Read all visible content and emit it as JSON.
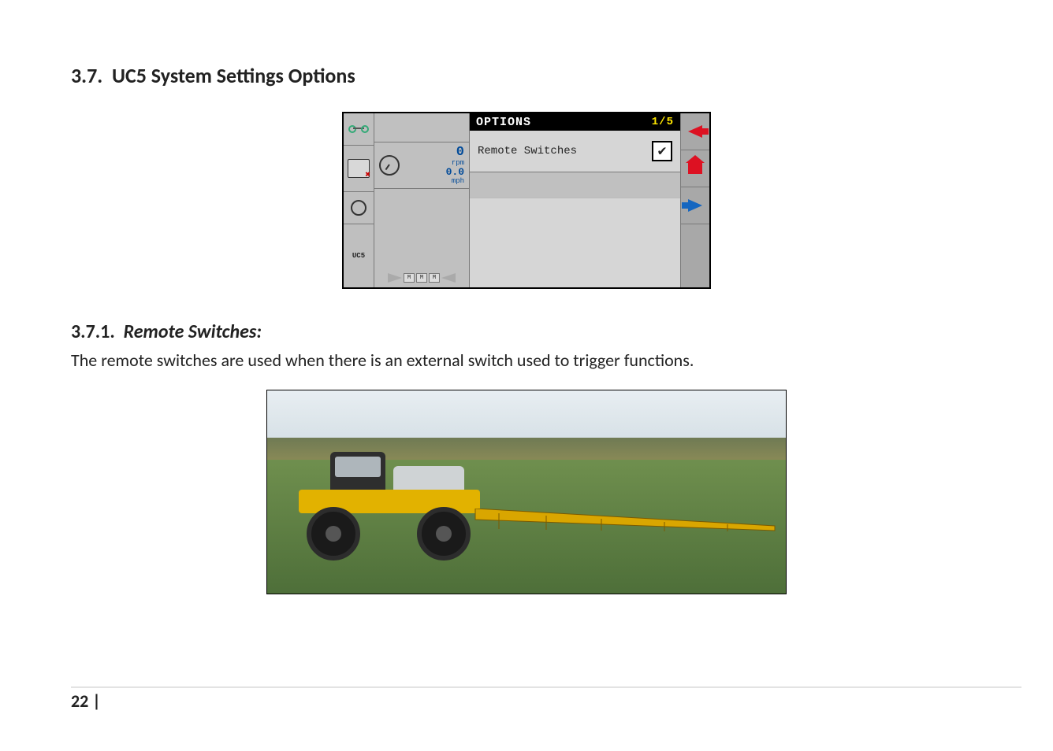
{
  "headings": {
    "sec_number": "3.7.",
    "sec_title": "UC5 System Settings Options",
    "sub_number": "3.7.1.",
    "sub_title": "Remote Switches:"
  },
  "body_text": "The remote switches are used when there is an external switch used to trigger functions.",
  "footer": {
    "page_label": "22 |"
  },
  "options_panel": {
    "title": "OPTIONS",
    "page_indicator": "1/5",
    "row_label": "Remote Switches",
    "row_checked": true,
    "stats": {
      "rpm_value": "0",
      "rpm_unit": "rpm",
      "speed_value": "0.0",
      "speed_unit": "mph"
    },
    "boom_sections": [
      "M",
      "M",
      "M"
    ],
    "left_tabs_uc5": "UC5",
    "softkeys": {
      "back": "back",
      "home": "home",
      "next": "next"
    }
  }
}
